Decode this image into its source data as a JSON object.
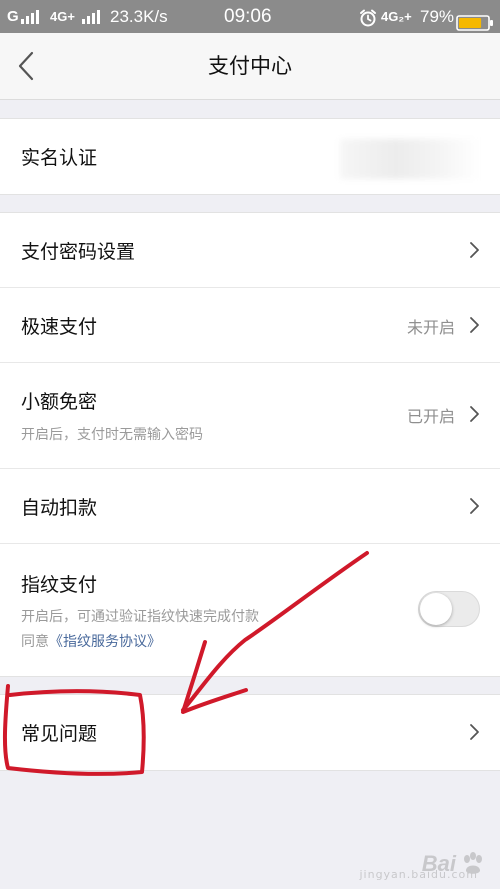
{
  "status_bar": {
    "carrier": "G",
    "network_primary": "4G+",
    "speed": "23.3K/s",
    "time": "09:06",
    "network_secondary": "4G₂+",
    "battery_percent": "79%",
    "battery_level": 0.79,
    "battery_color": "#f5b800",
    "alarm_icon": "alarm-clock-icon"
  },
  "nav": {
    "title": "支付中心",
    "back_icon": "chevron-left-icon"
  },
  "groups": [
    {
      "rows": [
        {
          "title": "实名认证",
          "value": ""
        }
      ]
    },
    {
      "rows": [
        {
          "title": "支付密码设置",
          "value": ""
        },
        {
          "title": "极速支付",
          "value": "未开启"
        },
        {
          "title": "小额免密",
          "value": "已开启",
          "desc": "开启后，支付时无需输入密码"
        },
        {
          "title": "自动扣款",
          "value": ""
        },
        {
          "title": "指纹支付",
          "desc": "开启后，可通过验证指纹快速完成付款",
          "agree_prefix": "同意",
          "agree_link": "《指纹服务协议》",
          "toggle_on": false
        }
      ]
    },
    {
      "rows": [
        {
          "title": "常见问题",
          "value": ""
        }
      ]
    }
  ],
  "annotation": {
    "color": "#d0192a"
  },
  "watermark": {
    "text": "Bai",
    "sub": "jingyan.baidu.com"
  }
}
